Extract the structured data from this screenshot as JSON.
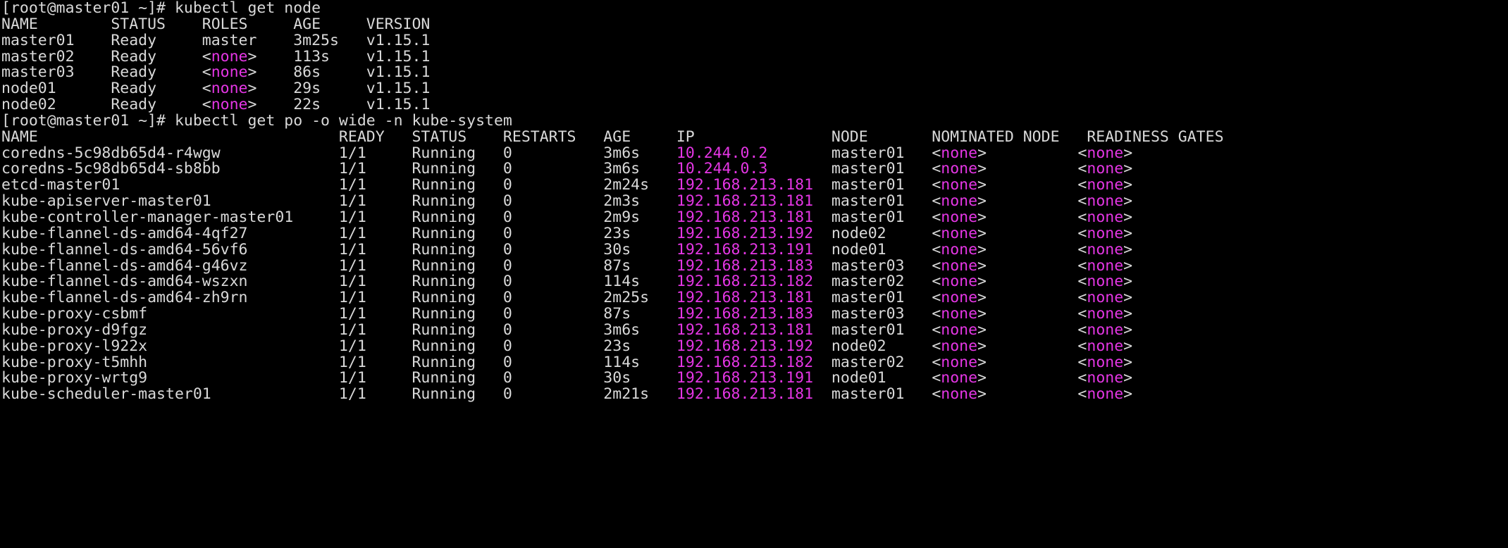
{
  "terminal": {
    "background_color": "#000000",
    "foreground_color": "#d9d9d9",
    "magenta_color": "#e536e5",
    "prompt": "[root@master01 ~]#",
    "lines": [
      {
        "id": "prompt-1",
        "segments": [
          {
            "text": "[root@master01 ~]# kubectl get node",
            "color": "default"
          }
        ]
      },
      {
        "id": "node-header",
        "segments": [
          {
            "text": "NAME        STATUS    ROLES     AGE     VERSION",
            "color": "default"
          }
        ]
      },
      {
        "id": "node-row-master01",
        "segments": [
          {
            "text": "master01    Ready     master    3m25s   v1.15.1",
            "color": "default"
          }
        ]
      },
      {
        "id": "node-row-master02",
        "segments": [
          {
            "text": "master02    Ready     <",
            "color": "default"
          },
          {
            "text": "none",
            "color": "magenta"
          },
          {
            "text": ">    113s    v1.15.1",
            "color": "default"
          }
        ]
      },
      {
        "id": "node-row-master03",
        "segments": [
          {
            "text": "master03    Ready     <",
            "color": "default"
          },
          {
            "text": "none",
            "color": "magenta"
          },
          {
            "text": ">    86s     v1.15.1",
            "color": "default"
          }
        ]
      },
      {
        "id": "node-row-node01",
        "segments": [
          {
            "text": "node01      Ready     <",
            "color": "default"
          },
          {
            "text": "none",
            "color": "magenta"
          },
          {
            "text": ">    29s     v1.15.1",
            "color": "default"
          }
        ]
      },
      {
        "id": "node-row-node02",
        "segments": [
          {
            "text": "node02      Ready     <",
            "color": "default"
          },
          {
            "text": "none",
            "color": "magenta"
          },
          {
            "text": ">    22s     v1.15.1",
            "color": "default"
          }
        ]
      },
      {
        "id": "prompt-2",
        "segments": [
          {
            "text": "[root@master01 ~]# kubectl get po -o wide -n kube-system",
            "color": "default"
          }
        ]
      },
      {
        "id": "pod-header",
        "segments": [
          {
            "text": "NAME                                 READY   STATUS    RESTARTS   AGE     IP               NODE       NOMINATED NODE   READINESS GATES",
            "color": "default"
          }
        ]
      },
      {
        "id": "pod-row-coredns-r4wgw",
        "segments": [
          {
            "text": "coredns-5c98db65d4-r4wgw             1/1     Running   0          3m6s    ",
            "color": "default"
          },
          {
            "text": "10.244.0.2",
            "color": "magenta"
          },
          {
            "text": "       master01   <",
            "color": "default"
          },
          {
            "text": "none",
            "color": "magenta"
          },
          {
            "text": ">          <",
            "color": "default"
          },
          {
            "text": "none",
            "color": "magenta"
          },
          {
            "text": ">",
            "color": "default"
          }
        ]
      },
      {
        "id": "pod-row-coredns-sb8bb",
        "segments": [
          {
            "text": "coredns-5c98db65d4-sb8bb             1/1     Running   0          3m6s    ",
            "color": "default"
          },
          {
            "text": "10.244.0.3",
            "color": "magenta"
          },
          {
            "text": "       master01   <",
            "color": "default"
          },
          {
            "text": "none",
            "color": "magenta"
          },
          {
            "text": ">          <",
            "color": "default"
          },
          {
            "text": "none",
            "color": "magenta"
          },
          {
            "text": ">",
            "color": "default"
          }
        ]
      },
      {
        "id": "pod-row-etcd-master01",
        "segments": [
          {
            "text": "etcd-master01                        1/1     Running   0          2m24s   ",
            "color": "default"
          },
          {
            "text": "192.168.213.181",
            "color": "magenta"
          },
          {
            "text": "  master01   <",
            "color": "default"
          },
          {
            "text": "none",
            "color": "magenta"
          },
          {
            "text": ">          <",
            "color": "default"
          },
          {
            "text": "none",
            "color": "magenta"
          },
          {
            "text": ">",
            "color": "default"
          }
        ]
      },
      {
        "id": "pod-row-kube-apiserver-master01",
        "segments": [
          {
            "text": "kube-apiserver-master01              1/1     Running   0          2m3s    ",
            "color": "default"
          },
          {
            "text": "192.168.213.181",
            "color": "magenta"
          },
          {
            "text": "  master01   <",
            "color": "default"
          },
          {
            "text": "none",
            "color": "magenta"
          },
          {
            "text": ">          <",
            "color": "default"
          },
          {
            "text": "none",
            "color": "magenta"
          },
          {
            "text": ">",
            "color": "default"
          }
        ]
      },
      {
        "id": "pod-row-kube-controller-manager-master01",
        "segments": [
          {
            "text": "kube-controller-manager-master01     1/1     Running   0          2m9s    ",
            "color": "default"
          },
          {
            "text": "192.168.213.181",
            "color": "magenta"
          },
          {
            "text": "  master01   <",
            "color": "default"
          },
          {
            "text": "none",
            "color": "magenta"
          },
          {
            "text": ">          <",
            "color": "default"
          },
          {
            "text": "none",
            "color": "magenta"
          },
          {
            "text": ">",
            "color": "default"
          }
        ]
      },
      {
        "id": "pod-row-flannel-4qf27",
        "segments": [
          {
            "text": "kube-flannel-ds-amd64-4qf27          1/1     Running   0          23s     ",
            "color": "default"
          },
          {
            "text": "192.168.213.192",
            "color": "magenta"
          },
          {
            "text": "  node02     <",
            "color": "default"
          },
          {
            "text": "none",
            "color": "magenta"
          },
          {
            "text": ">          <",
            "color": "default"
          },
          {
            "text": "none",
            "color": "magenta"
          },
          {
            "text": ">",
            "color": "default"
          }
        ]
      },
      {
        "id": "pod-row-flannel-56vf6",
        "segments": [
          {
            "text": "kube-flannel-ds-amd64-56vf6          1/1     Running   0          30s     ",
            "color": "default"
          },
          {
            "text": "192.168.213.191",
            "color": "magenta"
          },
          {
            "text": "  node01     <",
            "color": "default"
          },
          {
            "text": "none",
            "color": "magenta"
          },
          {
            "text": ">          <",
            "color": "default"
          },
          {
            "text": "none",
            "color": "magenta"
          },
          {
            "text": ">",
            "color": "default"
          }
        ]
      },
      {
        "id": "pod-row-flannel-g46vz",
        "segments": [
          {
            "text": "kube-flannel-ds-amd64-g46vz          1/1     Running   0          87s     ",
            "color": "default"
          },
          {
            "text": "192.168.213.183",
            "color": "magenta"
          },
          {
            "text": "  master03   <",
            "color": "default"
          },
          {
            "text": "none",
            "color": "magenta"
          },
          {
            "text": ">          <",
            "color": "default"
          },
          {
            "text": "none",
            "color": "magenta"
          },
          {
            "text": ">",
            "color": "default"
          }
        ]
      },
      {
        "id": "pod-row-flannel-wszxn",
        "segments": [
          {
            "text": "kube-flannel-ds-amd64-wszxn          1/1     Running   0          114s    ",
            "color": "default"
          },
          {
            "text": "192.168.213.182",
            "color": "magenta"
          },
          {
            "text": "  master02   <",
            "color": "default"
          },
          {
            "text": "none",
            "color": "magenta"
          },
          {
            "text": ">          <",
            "color": "default"
          },
          {
            "text": "none",
            "color": "magenta"
          },
          {
            "text": ">",
            "color": "default"
          }
        ]
      },
      {
        "id": "pod-row-flannel-zh9rn",
        "segments": [
          {
            "text": "kube-flannel-ds-amd64-zh9rn          1/1     Running   0          2m25s   ",
            "color": "default"
          },
          {
            "text": "192.168.213.181",
            "color": "magenta"
          },
          {
            "text": "  master01   <",
            "color": "default"
          },
          {
            "text": "none",
            "color": "magenta"
          },
          {
            "text": ">          <",
            "color": "default"
          },
          {
            "text": "none",
            "color": "magenta"
          },
          {
            "text": ">",
            "color": "default"
          }
        ]
      },
      {
        "id": "pod-row-proxy-csbmf",
        "segments": [
          {
            "text": "kube-proxy-csbmf                     1/1     Running   0          87s     ",
            "color": "default"
          },
          {
            "text": "192.168.213.183",
            "color": "magenta"
          },
          {
            "text": "  master03   <",
            "color": "default"
          },
          {
            "text": "none",
            "color": "magenta"
          },
          {
            "text": ">          <",
            "color": "default"
          },
          {
            "text": "none",
            "color": "magenta"
          },
          {
            "text": ">",
            "color": "default"
          }
        ]
      },
      {
        "id": "pod-row-proxy-d9fgz",
        "segments": [
          {
            "text": "kube-proxy-d9fgz                     1/1     Running   0          3m6s    ",
            "color": "default"
          },
          {
            "text": "192.168.213.181",
            "color": "magenta"
          },
          {
            "text": "  master01   <",
            "color": "default"
          },
          {
            "text": "none",
            "color": "magenta"
          },
          {
            "text": ">          <",
            "color": "default"
          },
          {
            "text": "none",
            "color": "magenta"
          },
          {
            "text": ">",
            "color": "default"
          }
        ]
      },
      {
        "id": "pod-row-proxy-l922x",
        "segments": [
          {
            "text": "kube-proxy-l922x                     1/1     Running   0          23s     ",
            "color": "default"
          },
          {
            "text": "192.168.213.192",
            "color": "magenta"
          },
          {
            "text": "  node02     <",
            "color": "default"
          },
          {
            "text": "none",
            "color": "magenta"
          },
          {
            "text": ">          <",
            "color": "default"
          },
          {
            "text": "none",
            "color": "magenta"
          },
          {
            "text": ">",
            "color": "default"
          }
        ]
      },
      {
        "id": "pod-row-proxy-t5mhh",
        "segments": [
          {
            "text": "kube-proxy-t5mhh                     1/1     Running   0          114s    ",
            "color": "default"
          },
          {
            "text": "192.168.213.182",
            "color": "magenta"
          },
          {
            "text": "  master02   <",
            "color": "default"
          },
          {
            "text": "none",
            "color": "magenta"
          },
          {
            "text": ">          <",
            "color": "default"
          },
          {
            "text": "none",
            "color": "magenta"
          },
          {
            "text": ">",
            "color": "default"
          }
        ]
      },
      {
        "id": "pod-row-proxy-wrtg9",
        "segments": [
          {
            "text": "kube-proxy-wrtg9                     1/1     Running   0          30s     ",
            "color": "default"
          },
          {
            "text": "192.168.213.191",
            "color": "magenta"
          },
          {
            "text": "  node01     <",
            "color": "default"
          },
          {
            "text": "none",
            "color": "magenta"
          },
          {
            "text": ">          <",
            "color": "default"
          },
          {
            "text": "none",
            "color": "magenta"
          },
          {
            "text": ">",
            "color": "default"
          }
        ]
      },
      {
        "id": "pod-row-scheduler-master01",
        "segments": [
          {
            "text": "kube-scheduler-master01              1/1     Running   0          2m21s   ",
            "color": "default"
          },
          {
            "text": "192.168.213.181",
            "color": "magenta"
          },
          {
            "text": "  master01   <",
            "color": "default"
          },
          {
            "text": "none",
            "color": "magenta"
          },
          {
            "text": ">          <",
            "color": "default"
          },
          {
            "text": "none",
            "color": "magenta"
          },
          {
            "text": ">",
            "color": "default"
          }
        ]
      }
    ]
  },
  "commands": [
    {
      "prompt": "[root@master01 ~]#",
      "command": "kubectl get node"
    },
    {
      "prompt": "[root@master01 ~]#",
      "command": "kubectl get po -o wide -n kube-system"
    }
  ],
  "node_table": {
    "headers": [
      "NAME",
      "STATUS",
      "ROLES",
      "AGE",
      "VERSION"
    ],
    "rows": [
      [
        "master01",
        "Ready",
        "master",
        "3m25s",
        "v1.15.1"
      ],
      [
        "master02",
        "Ready",
        "<none>",
        "113s",
        "v1.15.1"
      ],
      [
        "master03",
        "Ready",
        "<none>",
        "86s",
        "v1.15.1"
      ],
      [
        "node01",
        "Ready",
        "<none>",
        "29s",
        "v1.15.1"
      ],
      [
        "node02",
        "Ready",
        "<none>",
        "22s",
        "v1.15.1"
      ]
    ]
  },
  "pod_table": {
    "headers": [
      "NAME",
      "READY",
      "STATUS",
      "RESTARTS",
      "AGE",
      "IP",
      "NODE",
      "NOMINATED NODE",
      "READINESS GATES"
    ],
    "rows": [
      [
        "coredns-5c98db65d4-r4wgw",
        "1/1",
        "Running",
        "0",
        "3m6s",
        "10.244.0.2",
        "master01",
        "<none>",
        "<none>"
      ],
      [
        "coredns-5c98db65d4-sb8bb",
        "1/1",
        "Running",
        "0",
        "3m6s",
        "10.244.0.3",
        "master01",
        "<none>",
        "<none>"
      ],
      [
        "etcd-master01",
        "1/1",
        "Running",
        "0",
        "2m24s",
        "192.168.213.181",
        "master01",
        "<none>",
        "<none>"
      ],
      [
        "kube-apiserver-master01",
        "1/1",
        "Running",
        "0",
        "2m3s",
        "192.168.213.181",
        "master01",
        "<none>",
        "<none>"
      ],
      [
        "kube-controller-manager-master01",
        "1/1",
        "Running",
        "0",
        "2m9s",
        "192.168.213.181",
        "master01",
        "<none>",
        "<none>"
      ],
      [
        "kube-flannel-ds-amd64-4qf27",
        "1/1",
        "Running",
        "0",
        "23s",
        "192.168.213.192",
        "node02",
        "<none>",
        "<none>"
      ],
      [
        "kube-flannel-ds-amd64-56vf6",
        "1/1",
        "Running",
        "0",
        "30s",
        "192.168.213.191",
        "node01",
        "<none>",
        "<none>"
      ],
      [
        "kube-flannel-ds-amd64-g46vz",
        "1/1",
        "Running",
        "0",
        "87s",
        "192.168.213.183",
        "master03",
        "<none>",
        "<none>"
      ],
      [
        "kube-flannel-ds-amd64-wszxn",
        "1/1",
        "Running",
        "0",
        "114s",
        "192.168.213.182",
        "master02",
        "<none>",
        "<none>"
      ],
      [
        "kube-flannel-ds-amd64-zh9rn",
        "1/1",
        "Running",
        "0",
        "2m25s",
        "192.168.213.181",
        "master01",
        "<none>",
        "<none>"
      ],
      [
        "kube-proxy-csbmf",
        "1/1",
        "Running",
        "0",
        "87s",
        "192.168.213.183",
        "master03",
        "<none>",
        "<none>"
      ],
      [
        "kube-proxy-d9fgz",
        "1/1",
        "Running",
        "0",
        "3m6s",
        "192.168.213.181",
        "master01",
        "<none>",
        "<none>"
      ],
      [
        "kube-proxy-l922x",
        "1/1",
        "Running",
        "0",
        "23s",
        "192.168.213.192",
        "node02",
        "<none>",
        "<none>"
      ],
      [
        "kube-proxy-t5mhh",
        "1/1",
        "Running",
        "0",
        "114s",
        "192.168.213.182",
        "master02",
        "<none>",
        "<none>"
      ],
      [
        "kube-proxy-wrtg9",
        "1/1",
        "Running",
        "0",
        "30s",
        "192.168.213.191",
        "node01",
        "<none>",
        "<none>"
      ],
      [
        "kube-scheduler-master01",
        "1/1",
        "Running",
        "0",
        "2m21s",
        "192.168.213.181",
        "master01",
        "<none>",
        "<none>"
      ]
    ]
  }
}
